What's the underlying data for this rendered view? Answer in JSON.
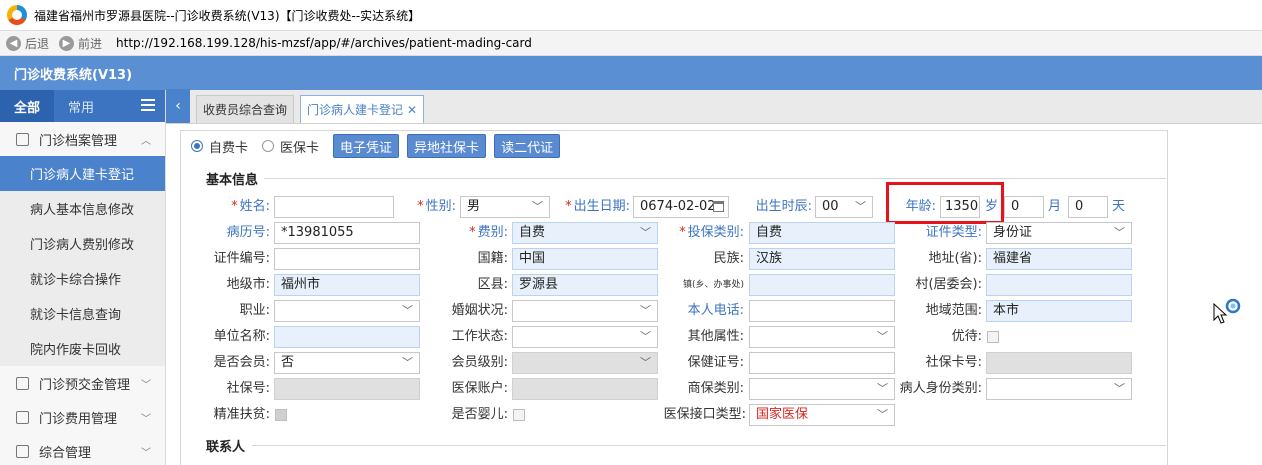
{
  "window": {
    "title": "福建省福州市罗源县医院--门诊收费系统(V13)【门诊收费处--实达系统】"
  },
  "browser": {
    "back_label": "后退",
    "forward_label": "前进",
    "url": "http://192.168.199.128/his-mzsf/app/#/archives/patient-mading-card"
  },
  "app": {
    "header_title": "门诊收费系统(V13)"
  },
  "sidebar": {
    "tabs": [
      {
        "label": "全部"
      },
      {
        "label": "常用"
      }
    ],
    "groups": [
      {
        "label": "门诊档案管理"
      },
      {
        "label": "门诊预交金管理"
      },
      {
        "label": "门诊费用管理"
      },
      {
        "label": "综合管理"
      }
    ],
    "items": [
      {
        "label": "门诊病人建卡登记"
      },
      {
        "label": "病人基本信息修改"
      },
      {
        "label": "门诊病人费别修改"
      },
      {
        "label": "就诊卡综合操作"
      },
      {
        "label": "就诊卡信息查询"
      },
      {
        "label": "院内作废卡回收"
      }
    ]
  },
  "tabs": [
    {
      "label": "收费员综合查询"
    },
    {
      "label": "门诊病人建卡登记"
    }
  ],
  "toolbar": {
    "radio_self": "自费卡",
    "radio_insurance": "医保卡",
    "btn_evoucher": "电子凭证",
    "btn_remote": "异地社保卡",
    "btn_idcard": "读二代证"
  },
  "sections": {
    "basic": "基本信息",
    "contact": "联系人"
  },
  "labels": {
    "name": "姓名:",
    "gender": "性别:",
    "birthdate": "出生日期:",
    "birthhour": "出生时辰:",
    "age": "年龄:",
    "record_no": "病历号:",
    "fee_type": "费别:",
    "ins_type": "投保类别:",
    "cert_type": "证件类型:",
    "cert_no": "证件编号:",
    "nationality": "国籍:",
    "ethnicity": "民族:",
    "province": "地址(省):",
    "city": "地级市:",
    "county": "区县:",
    "town": "镇(乡、办事处)",
    "village": "村(居委会):",
    "occupation": "职业:",
    "marital": "婚姻状况:",
    "phone": "本人电话:",
    "region": "地域范围:",
    "employer": "单位名称:",
    "work_status": "工作状态:",
    "other_attr": "其他属性:",
    "priority": "优待:",
    "member": "是否会员:",
    "member_level": "会员级别:",
    "health_cert": "保健证号:",
    "si_card": "社保卡号:",
    "si_no": "社保号:",
    "ins_account": "医保账户:",
    "comm_ins": "商保类别:",
    "identity": "病人身份类别:",
    "poverty": "精准扶贫:",
    "infant": "是否婴儿:",
    "ins_interface": "医保接口类型:"
  },
  "units": {
    "year": "岁",
    "month": "月",
    "day": "天"
  },
  "values": {
    "gender": "男",
    "birthdate": "0674-02-02",
    "birthhour": "00",
    "age_years": "1350",
    "age_months": "0",
    "age_days": "0",
    "record_no": "*13981055",
    "fee_type": "自费",
    "ins_type": "自费",
    "cert_type": "身份证",
    "nationality": "中国",
    "ethnicity": "汉族",
    "province": "福建省",
    "city": "福州市",
    "county": "罗源县",
    "region": "本市",
    "member": "否",
    "ins_interface": "国家医保"
  }
}
